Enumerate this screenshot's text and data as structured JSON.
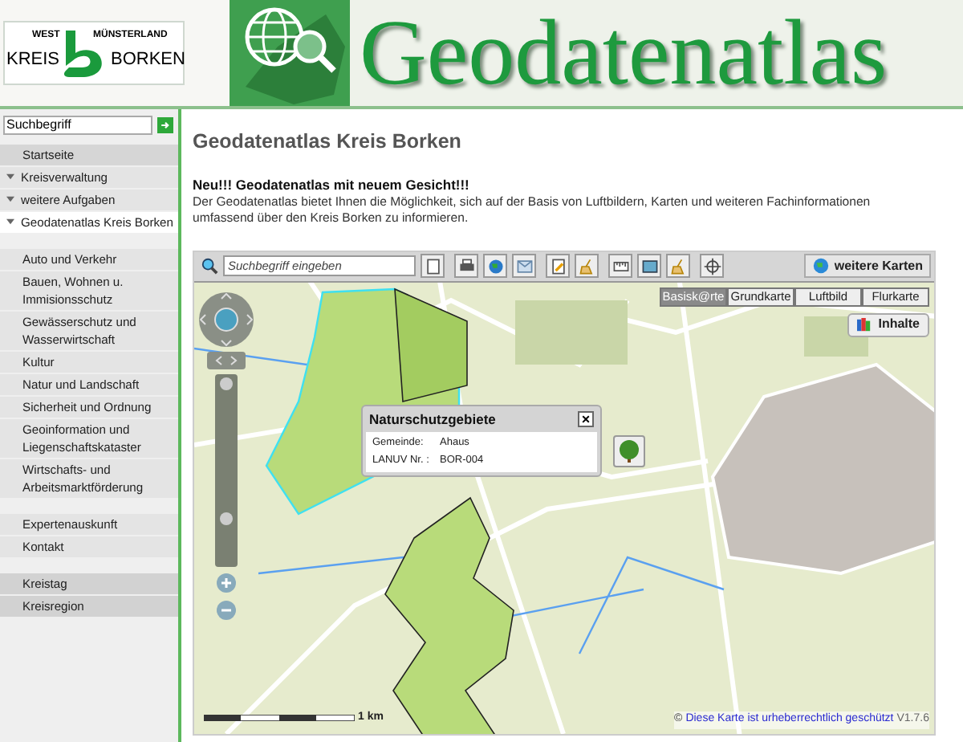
{
  "header": {
    "logo": {
      "top_left": "WEST",
      "top_right": "MÜNSTERLAND",
      "left": "KREIS",
      "right": "BORKEN"
    },
    "title": "Geodatenatlas"
  },
  "sidebar": {
    "search": {
      "placeholder": "Suchbegriff"
    },
    "groups": [
      {
        "items": [
          {
            "label": "Startseite",
            "kind": "home",
            "expandable": false,
            "selected": false
          },
          {
            "label": "Kreisverwaltung",
            "kind": "top",
            "expandable": true,
            "selected": false
          },
          {
            "label": "weitere Aufgaben",
            "kind": "top",
            "expandable": true,
            "selected": false
          },
          {
            "label": "Geodatenatlas Kreis Borken",
            "kind": "top",
            "expandable": true,
            "selected": true
          }
        ]
      },
      {
        "items": [
          {
            "label": "Auto und Verkehr",
            "kind": "sub",
            "expandable": false,
            "selected": false
          },
          {
            "label": "Bauen, Wohnen u. Immisionsschutz",
            "kind": "sub",
            "expandable": false,
            "selected": false
          },
          {
            "label": "Gewässerschutz und Wasserwirtschaft",
            "kind": "sub",
            "expandable": false,
            "selected": false
          },
          {
            "label": "Kultur",
            "kind": "sub",
            "expandable": false,
            "selected": false
          },
          {
            "label": "Natur und Landschaft",
            "kind": "sub",
            "expandable": false,
            "selected": false
          },
          {
            "label": "Sicherheit und Ordnung",
            "kind": "sub",
            "expandable": false,
            "selected": false
          },
          {
            "label": "Geoinformation und Liegenschaftskataster",
            "kind": "sub",
            "expandable": false,
            "selected": false
          },
          {
            "label": "Wirtschafts- und Arbeitsmarktförderung",
            "kind": "sub",
            "expandable": false,
            "selected": false
          }
        ]
      },
      {
        "items": [
          {
            "label": "Expertenauskunft",
            "kind": "sub",
            "expandable": false,
            "selected": false
          },
          {
            "label": "Kontakt",
            "kind": "sub",
            "expandable": false,
            "selected": false
          }
        ]
      },
      {
        "items": [
          {
            "label": "Kreistag",
            "kind": "section",
            "expandable": false,
            "selected": false
          },
          {
            "label": "Kreisregion",
            "kind": "section",
            "expandable": false,
            "selected": false
          }
        ]
      }
    ]
  },
  "main": {
    "heading": "Geodatenatlas Kreis Borken",
    "subheading": "Neu!!! Geodatenatlas mit neuem Gesicht!!!",
    "text": "Der Geodatenatlas bietet Ihnen die Möglichkeit, sich auf der Basis von Luftbildern, Karten und weiteren Fachinformationen umfassend über den Kreis Borken zu informieren."
  },
  "map": {
    "search": {
      "placeholder": "Suchbegriff eingeben"
    },
    "more_maps": "weitere Karten",
    "layers": [
      {
        "label": "Basisk@rte",
        "selected": true
      },
      {
        "label": "Grundkarte",
        "selected": false
      },
      {
        "label": "Luftbild",
        "selected": false
      },
      {
        "label": "Flurkarte",
        "selected": false
      }
    ],
    "contents_button": "Inhalte",
    "popup": {
      "title": "Naturschutzgebiete",
      "close": "×",
      "rows": [
        {
          "label": "Gemeinde:",
          "value": "Ahaus"
        },
        {
          "label": "LANUV Nr. :",
          "value": "BOR-004"
        }
      ]
    },
    "scale": "1 km",
    "copyright": {
      "symbol": "©",
      "link": "Diese Karte ist urheberrechtlich geschützt",
      "version": "V1.7.6"
    }
  }
}
